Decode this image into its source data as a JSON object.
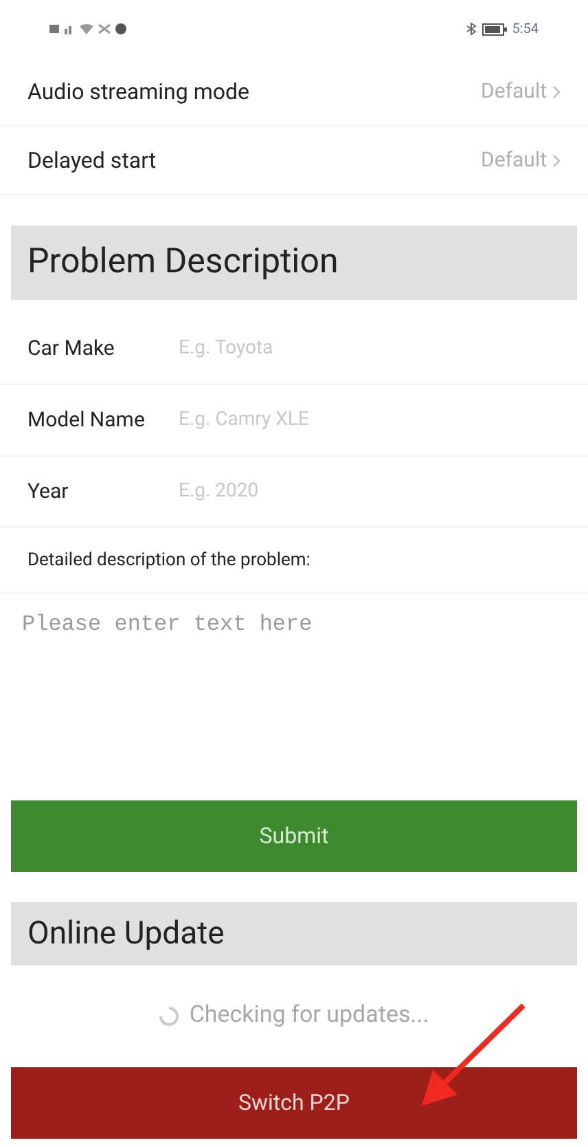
{
  "status_bar": {
    "time": "5:54"
  },
  "settings": [
    {
      "label": "Audio streaming mode",
      "value": "Default"
    },
    {
      "label": "Delayed start",
      "value": "Default"
    }
  ],
  "problem_section": {
    "title": "Problem Description",
    "fields": [
      {
        "label": "Car Make",
        "placeholder": "E.g. Toyota"
      },
      {
        "label": "Model Name",
        "placeholder": "E.g. Camry XLE"
      },
      {
        "label": "Year",
        "placeholder": "E.g. 2020"
      }
    ],
    "description_label": "Detailed description of the problem:",
    "description_placeholder": "Please enter text here",
    "submit": "Submit"
  },
  "update_section": {
    "title": "Online Update",
    "status": "Checking for updates...",
    "button": "Switch P2P"
  }
}
